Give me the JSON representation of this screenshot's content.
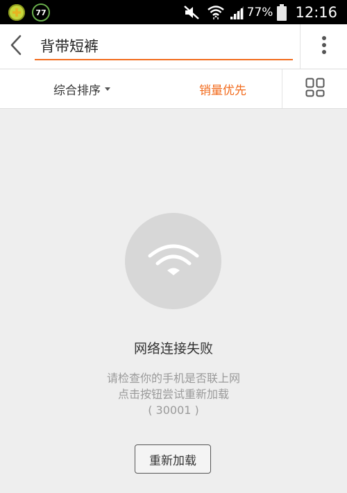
{
  "status_bar": {
    "badge_number": "77",
    "battery_percent": "77%",
    "time": "12:16",
    "icons": [
      "360-security-icon",
      "mute-icon",
      "wifi-icon",
      "signal-icon",
      "battery-icon"
    ]
  },
  "header": {
    "search_value": "背带短裤",
    "icons": [
      "back-arrow-icon",
      "more-vertical-icon"
    ]
  },
  "sort_bar": {
    "default_sort_label": "综合排序",
    "sales_sort_label": "销量优先",
    "active_tab": "sales",
    "icons": [
      "chevron-down-icon",
      "grid-view-icon"
    ]
  },
  "error": {
    "icon": "wifi-icon",
    "title": "网络连接失败",
    "line1": "请检查你的手机是否联上网",
    "line2": "点击按钮尝试重新加载",
    "code": "( 30001 )",
    "reload_label": "重新加载"
  },
  "colors": {
    "accent": "#f26a1b",
    "background": "#eeeeee",
    "status_bar": "#000000"
  }
}
